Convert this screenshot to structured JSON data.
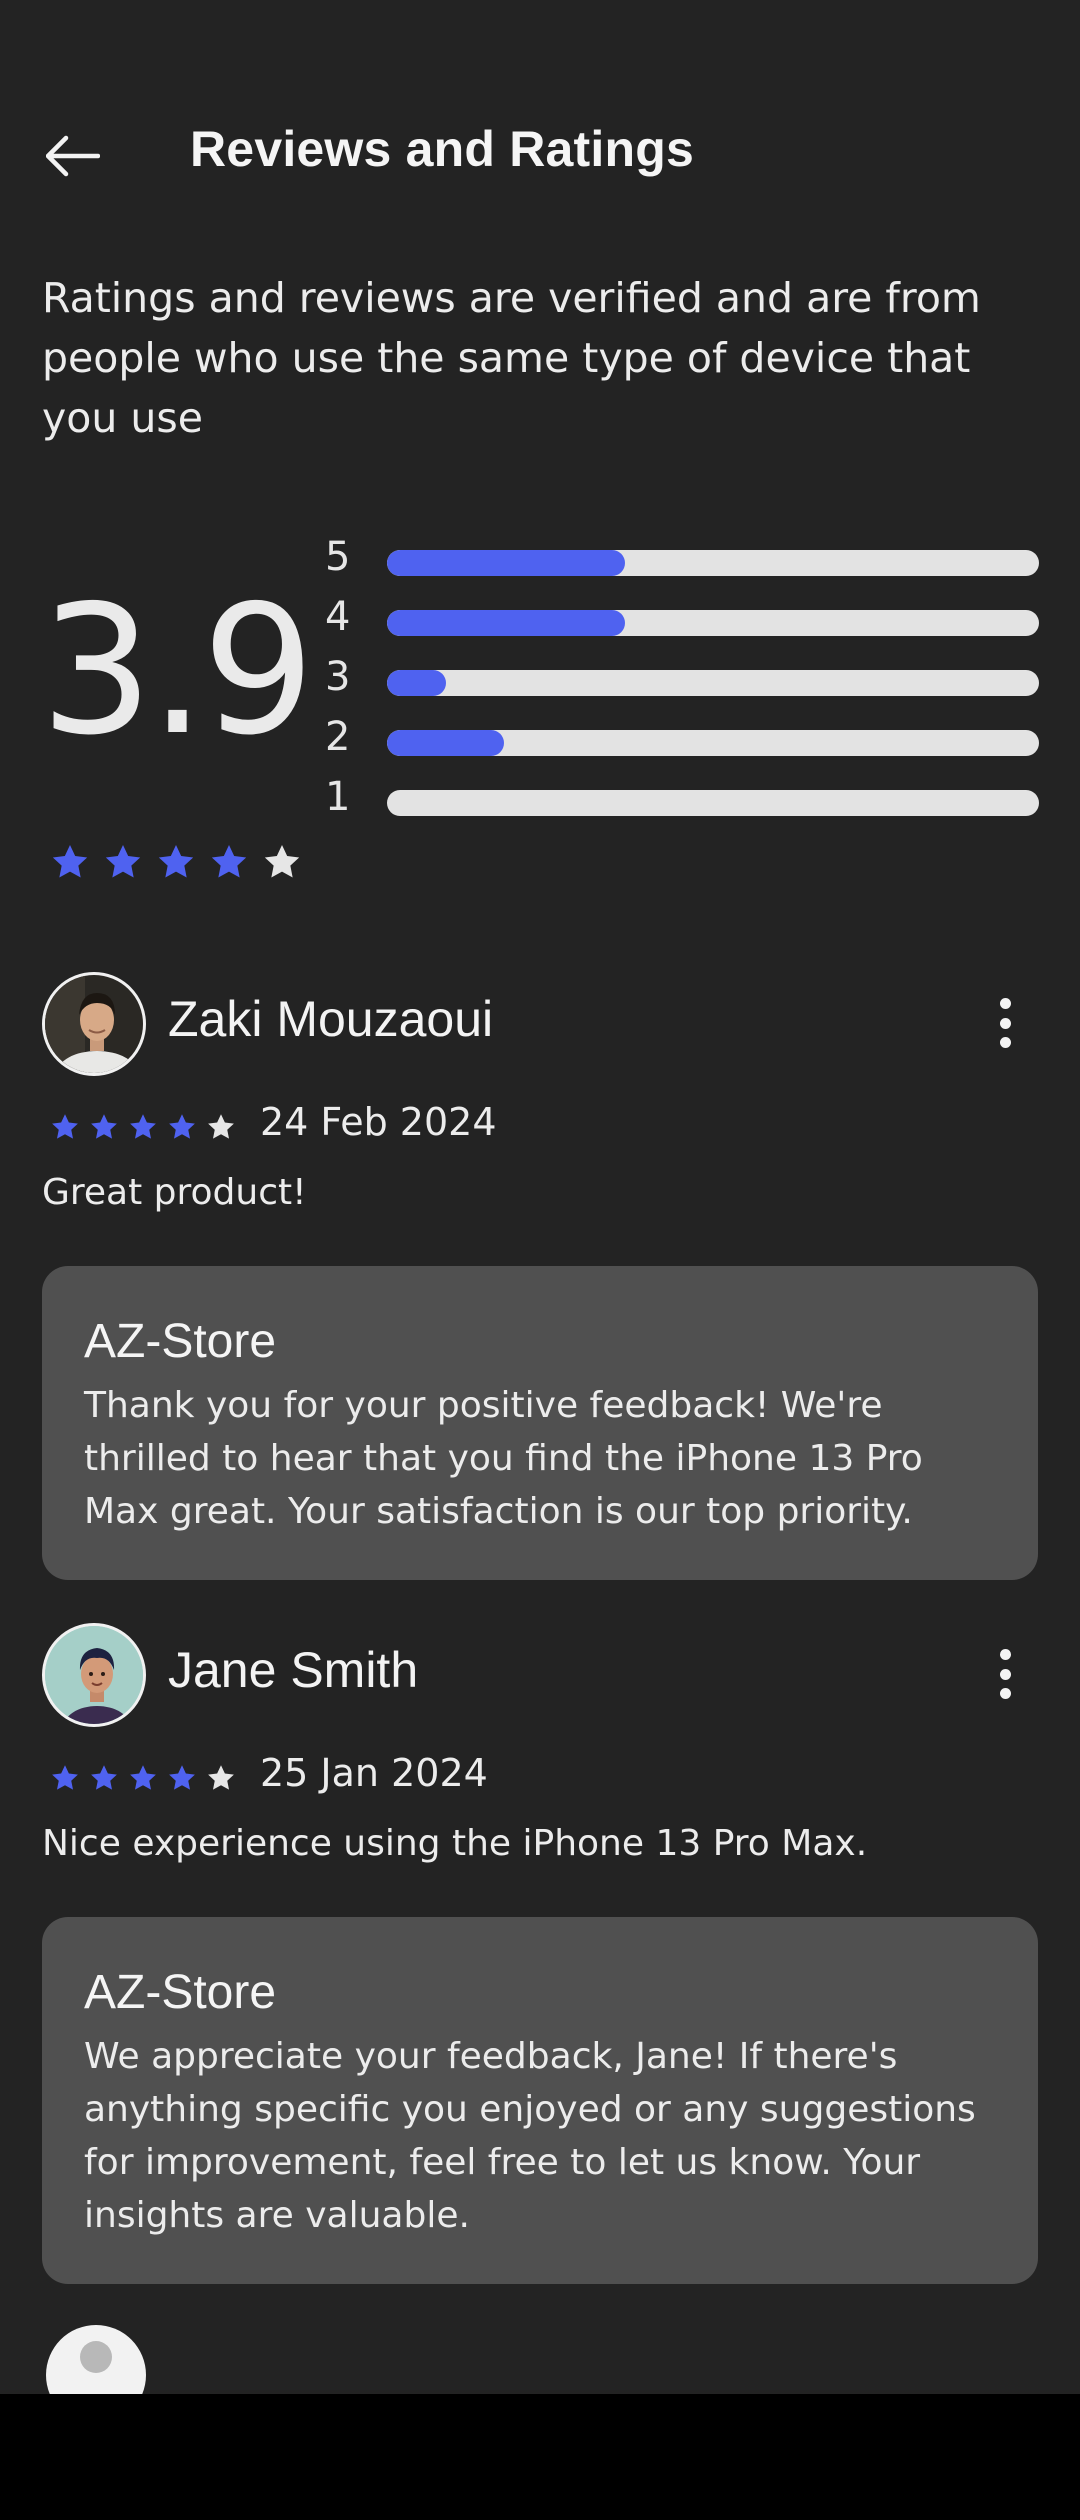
{
  "header": {
    "title": "Reviews and Ratings",
    "back_icon": "arrow-left-icon"
  },
  "intro": "Ratings and reviews are verified and are from people who use the same type of device that you use",
  "summary": {
    "average": "3.9",
    "stars_filled": 4,
    "stars_total": 5,
    "bars": [
      {
        "label": "5",
        "fraction": 0.365
      },
      {
        "label": "4",
        "fraction": 0.365
      },
      {
        "label": "3",
        "fraction": 0.09
      },
      {
        "label": "2",
        "fraction": 0.18
      },
      {
        "label": "1",
        "fraction": 0.0
      }
    ]
  },
  "colors": {
    "accent": "#4f62f0",
    "star_empty": "#e6e6e6",
    "background": "#232323",
    "card": "#505050"
  },
  "reviews": [
    {
      "name": "Zaki Mouzaoui",
      "date": "24 Feb 2024",
      "stars": 4,
      "text": "Great product!",
      "reply": {
        "author": "AZ-Store",
        "text": "Thank you for your positive feedback! We're thrilled to hear that you find the iPhone 13 Pro Max great. Your satisfaction is our top priority."
      }
    },
    {
      "name": "Jane Smith",
      "date": "25 Jan 2024",
      "stars": 4,
      "text": "Nice experience using the iPhone 13 Pro Max.",
      "reply": {
        "author": "AZ-Store",
        "text": "We appreciate your feedback, Jane! If there's anything specific you enjoyed or any suggestions for improvement, feel free to let us know. Your insights are valuable."
      }
    }
  ]
}
